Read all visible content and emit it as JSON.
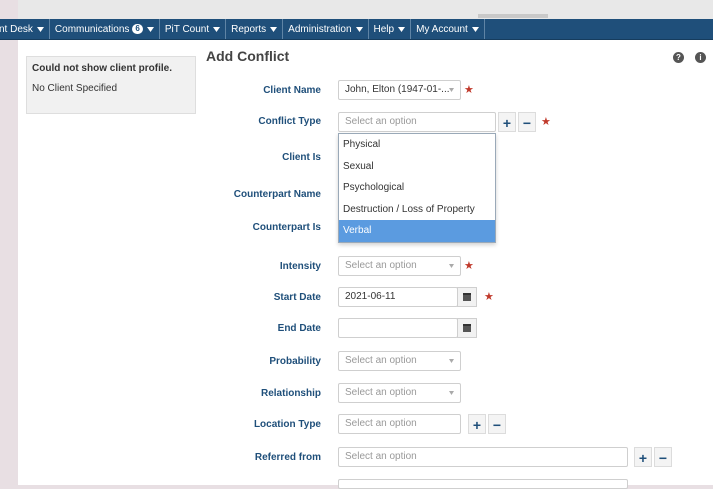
{
  "navbar": {
    "items": [
      {
        "label": "Front Desk"
      },
      {
        "label": "Communications",
        "badge": "6"
      },
      {
        "label": "PiT Count"
      },
      {
        "label": "Reports"
      },
      {
        "label": "Administration"
      },
      {
        "label": "Help"
      },
      {
        "label": "My Account"
      }
    ]
  },
  "side": {
    "title": "Could not show client profile.",
    "message": "No Client Specified"
  },
  "page": {
    "title": "Add Conflict"
  },
  "help_icons": [
    "?",
    "i"
  ],
  "form": {
    "client_name": {
      "label": "Client Name",
      "value": "John, Elton (1947-01-..."
    },
    "conflict_type": {
      "label": "Conflict Type",
      "placeholder": "Select an option"
    },
    "client_is": {
      "label": "Client Is"
    },
    "counterpart_name": {
      "label": "Counterpart Name"
    },
    "counterpart_is": {
      "label": "Counterpart Is"
    },
    "intensity": {
      "label": "Intensity",
      "placeholder": "Select an option"
    },
    "start_date": {
      "label": "Start Date",
      "value": "2021-06-11"
    },
    "end_date": {
      "label": "End Date",
      "value": ""
    },
    "probability": {
      "label": "Probability",
      "placeholder": "Select an option"
    },
    "relationship": {
      "label": "Relationship",
      "placeholder": "Select an option"
    },
    "location_type": {
      "label": "Location Type",
      "placeholder": "Select an option"
    },
    "referred_from": {
      "label": "Referred from",
      "placeholder": "Select an option"
    }
  },
  "dropdown": {
    "options": [
      "Physical",
      "Sexual",
      "Psychological",
      "Destruction / Loss of Property",
      "Verbal"
    ],
    "highlighted": "Verbal"
  },
  "symbols": {
    "add": "+",
    "remove": "−",
    "required": "★"
  },
  "colors": {
    "navbar": "#1f4f7a",
    "label": "#1f4f7a",
    "required": "#c0392b",
    "highlight": "#5b9be0"
  }
}
